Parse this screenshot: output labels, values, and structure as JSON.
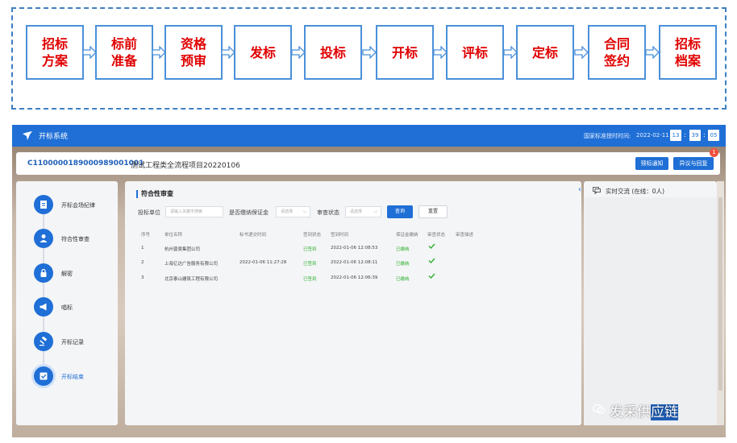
{
  "flow": {
    "steps": [
      "招标\n方案",
      "标前\n准备",
      "资格\n预审",
      "发标",
      "投标",
      "开标",
      "评标",
      "定标",
      "合同\n签约",
      "招标\n档案"
    ]
  },
  "app": {
    "title": "开标系统",
    "clock": {
      "label": "国家标准授时时间:",
      "date": "2022-02-11",
      "hour": "13",
      "minute": "39",
      "second": "05"
    },
    "project": {
      "code": "C1100000189000989001001",
      "name": "测试工程类全流程项目20220106"
    },
    "buttons": {
      "notice": "预标通知",
      "objection": "异议与回复"
    },
    "badge_count": "1",
    "sidebar": {
      "items": [
        {
          "label": "开标会场纪律",
          "icon": "document-icon"
        },
        {
          "label": "符合性审查",
          "icon": "person-icon"
        },
        {
          "label": "解密",
          "icon": "lock-icon"
        },
        {
          "label": "唱标",
          "icon": "megaphone-icon"
        },
        {
          "label": "开标记录",
          "icon": "gavel-icon"
        },
        {
          "label": "开标结束",
          "icon": "checkbox-icon"
        }
      ],
      "active_index": 5
    },
    "main": {
      "section_title": "符合性审查",
      "filters": {
        "unit_label": "投标单位",
        "unit_placeholder": "请输入关键字搜索",
        "deposit_label": "是否缴纳保证金",
        "deposit_placeholder": "请选择",
        "status_label": "审查状态",
        "status_placeholder": "请选择",
        "query": "查询",
        "reset": "重置"
      },
      "table": {
        "headers": [
          "序号",
          "单位名称",
          "标书递交时间",
          "签到状态",
          "签到时间",
          "保证金缴纳",
          "审查状态",
          "审查描述"
        ],
        "rows": [
          {
            "no": "1",
            "name": "杭州普景集团公司",
            "submit_time": "",
            "sign_status": "已签到",
            "sign_time": "2022-01-06 12:08:53",
            "deposit": "已缴纳",
            "review": "check"
          },
          {
            "no": "2",
            "name": "上海亿达广告服务有限公司",
            "submit_time": "2022-01-06 11:27:28",
            "sign_status": "已签到",
            "sign_time": "2022-01-06 12:08:11",
            "deposit": "已缴纳",
            "review": "check"
          },
          {
            "no": "3",
            "name": "北京泰山建筑工程有限公司",
            "submit_time": "",
            "sign_status": "已签到",
            "sign_time": "2022-01-06 12:06:39",
            "deposit": "已缴纳",
            "review": "check"
          }
        ]
      }
    },
    "chat": {
      "title": "实时交流 (在线：0人)"
    },
    "watermark": {
      "prefix": "发采供",
      "highlight": "应链"
    }
  },
  "colors": {
    "primary": "#1f6fd6",
    "step_text": "#e00000",
    "step_border": "#4a90d9",
    "success": "#2fb12f"
  }
}
